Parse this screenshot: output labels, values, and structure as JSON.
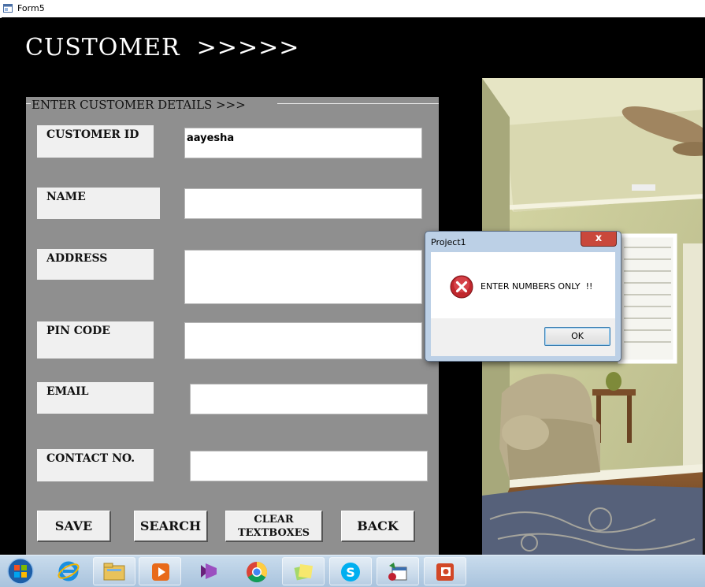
{
  "window": {
    "title": "Form5"
  },
  "form": {
    "heading": "CUSTOMER  >>>>>",
    "frame_caption": "ENTER CUSTOMER DETAILS >>>",
    "fields": [
      {
        "label": "CUSTOMER ID",
        "value": "aayesha"
      },
      {
        "label": "NAME",
        "value": ""
      },
      {
        "label": "ADDRESS",
        "value": ""
      },
      {
        "label": "PIN  CODE",
        "value": ""
      },
      {
        "label": "EMAIL",
        "value": ""
      },
      {
        "label": "CONTACT NO.",
        "value": ""
      }
    ],
    "buttons": {
      "save": "SAVE",
      "search": "SEARCH",
      "clear_line1": "CLEAR",
      "clear_line2": "TEXTBOXES",
      "back": "BACK"
    }
  },
  "dialog": {
    "title": "Project1",
    "message": "ENTER NUMBERS ONLY  !!",
    "ok_label": "OK",
    "close_glyph": "x"
  },
  "taskbar": {
    "icons": [
      "windows-start-icon",
      "internet-explorer-icon",
      "file-explorer-icon",
      "media-player-icon",
      "visual-studio-icon",
      "chrome-icon",
      "sticky-notes-icon",
      "skype-icon",
      "vb6-project-icon",
      "powerpoint-icon"
    ]
  }
}
